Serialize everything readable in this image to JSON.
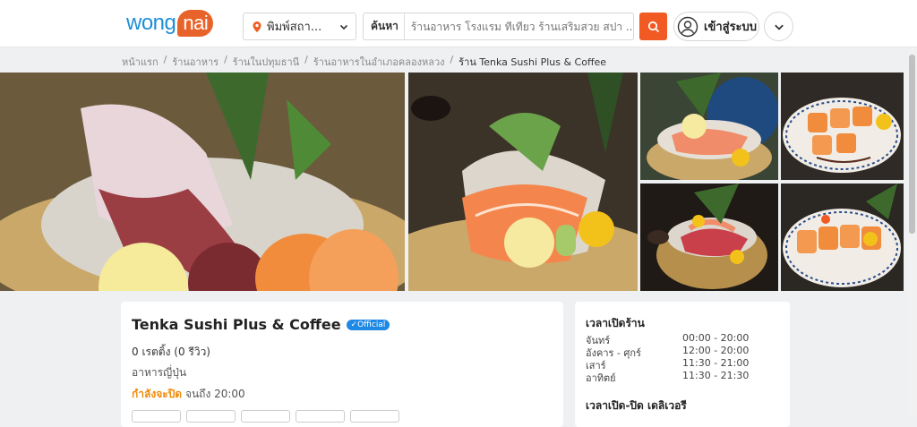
{
  "header": {
    "logo_text": "wong",
    "logo_bubble": "nai",
    "location": "พิมพ์สถา...",
    "search_label": "ค้นหา",
    "search_placeholder": "ร้านอาหาร โรงแรม ที่เที่ยว ร้านเสริมสวย สปา ...",
    "login": "เข้าสู่ระบบ"
  },
  "breadcrumb": [
    "หน้าแรก",
    "/",
    "ร้านอาหาร",
    "/",
    "ร้านในปทุมธานี",
    "/",
    "ร้านอาหารในอำเภอคลองหลวง",
    "/",
    "ร้าน Tenka Sushi Plus & Coffee"
  ],
  "restaurant": {
    "name": "Tenka Sushi Plus & Coffee",
    "badge": "Official",
    "rating": "0 เรตติ้ง (0 รีวิว)",
    "cuisine": "อาหารญี่ปุ่น",
    "status": "กำลังจะปิด",
    "until": "จนถึง 20:00"
  },
  "hours": {
    "title": "เวลาเปิดร้าน",
    "rows": [
      {
        "day": "จันทร์",
        "time": "00:00 - 20:00"
      },
      {
        "day": "อังคาร - ศุกร์",
        "time": "12:00 - 20:00"
      },
      {
        "day": "เสาร์",
        "time": "11:30 - 21:00"
      },
      {
        "day": "อาทิตย์",
        "time": "11:30 - 21:30"
      }
    ],
    "delivery_title": "เวลาเปิด-ปิด เดลิเวอรี"
  },
  "colors": {
    "brand_blue": "#1f8fd6",
    "accent_orange": "#f15a22",
    "status_orange": "#f28a0a"
  }
}
